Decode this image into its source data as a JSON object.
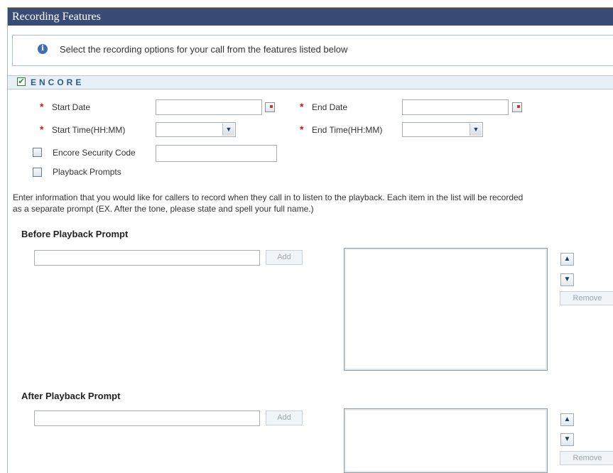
{
  "header": {
    "title": "Recording Features"
  },
  "info": {
    "icon": "info-icon",
    "glyph": "i",
    "text": "Select the recording options for your call from the features listed below"
  },
  "section": {
    "title": "ENCORE",
    "checked": true,
    "check_glyph": "✔"
  },
  "form": {
    "required_marker": "*",
    "start_date_label": "Start Date",
    "end_date_label": "End Date",
    "start_time_label": "Start Time(HH:MM)",
    "end_time_label": "End Time(HH:MM)",
    "start_date_value": "",
    "end_date_value": "",
    "start_time_value": "",
    "end_time_value": "",
    "security_code_label": "Encore Security Code",
    "security_code_value": "",
    "playback_prompts_label": "Playback Prompts",
    "dropdown_glyph": "▼"
  },
  "instructions": {
    "line1": "Enter information that you would like for callers to record when they call in to listen to the playback. Each item in the list will be recorded",
    "line2": "as a separate prompt (EX. After the tone, please state and spell your full name.)"
  },
  "before_prompt": {
    "heading": "Before Playback Prompt",
    "input_value": "",
    "add_label": "Add",
    "remove_label": "Remove",
    "up_glyph": "▲",
    "down_glyph": "▼"
  },
  "after_prompt": {
    "heading": "After Playback Prompt",
    "input_value": "",
    "add_label": "Add",
    "remove_label": "Remove",
    "up_glyph": "▲",
    "down_glyph": "▼"
  }
}
